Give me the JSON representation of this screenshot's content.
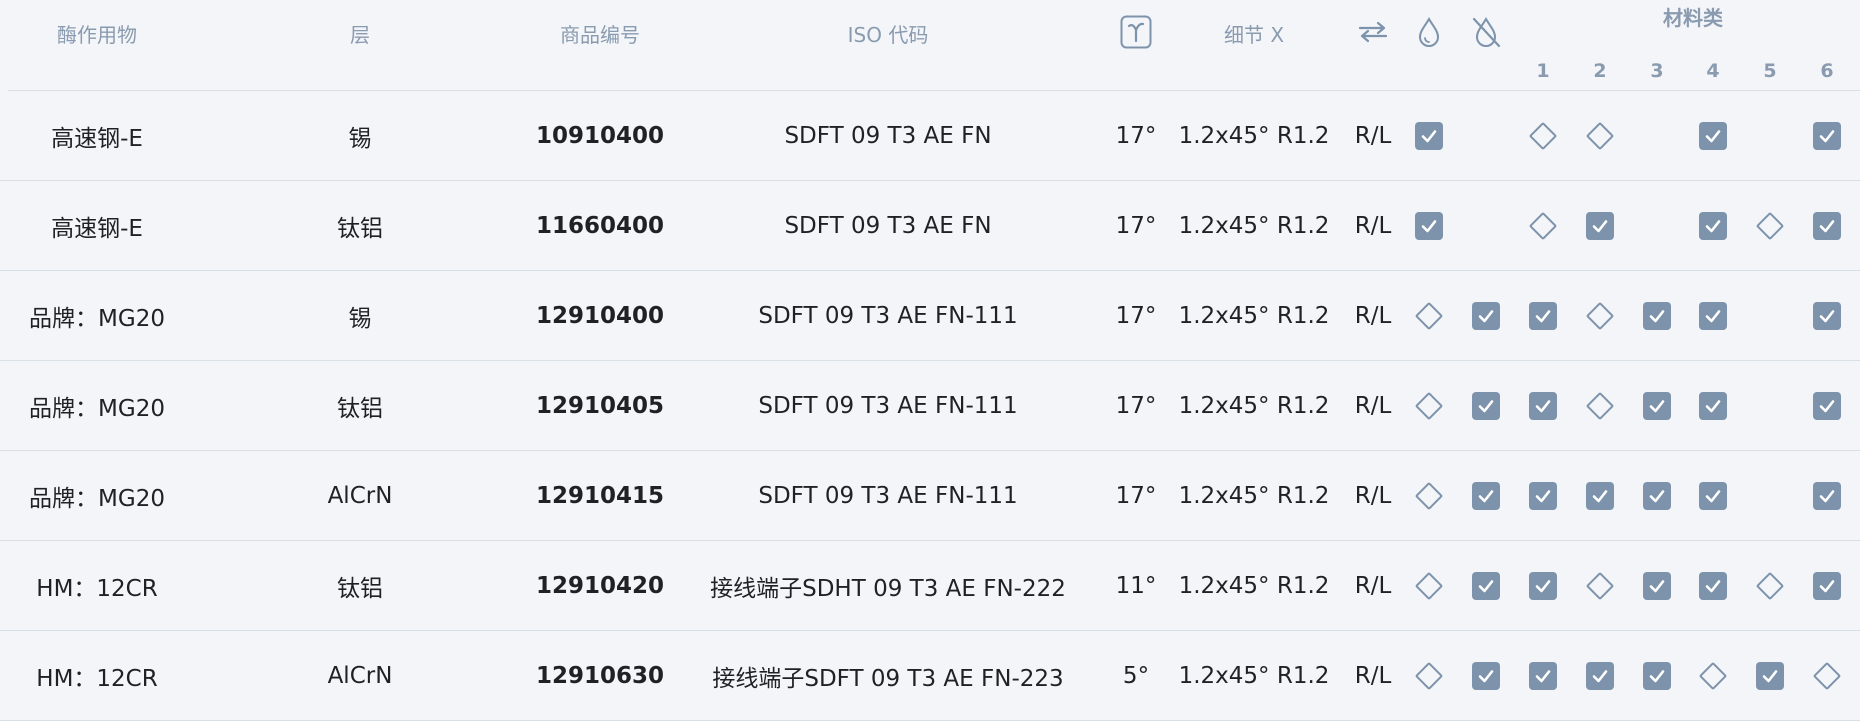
{
  "header": {
    "enzyme": "酶作用物",
    "layer": "层",
    "item_no": "商品编号",
    "iso": "ISO 代码",
    "detail": "细节 X",
    "material_class": "材料类",
    "material_numbers": [
      "1",
      "2",
      "3",
      "4",
      "5",
      "6"
    ],
    "icons": [
      "gamma-angle-icon",
      "swap-direction-icon",
      "coolant-icon",
      "no-coolant-icon"
    ]
  },
  "colors": {
    "accent": "#7d92ab",
    "header_text": "#8a9bb0",
    "background": "#f3f5f9",
    "divider": "#d9dfe7"
  },
  "rows": [
    {
      "enzyme": "高速钢-E",
      "layer": "锡",
      "item_no": "10910400",
      "iso": "SDFT 09 T3 AE FN",
      "angle": "17°",
      "detail": "1.2x45° R1.2",
      "direction": "R/L",
      "marks": [
        "check",
        "none",
        "diamond",
        "diamond",
        "none",
        "check",
        "none",
        "check"
      ]
    },
    {
      "enzyme": "高速钢-E",
      "layer": "钛铝",
      "item_no": "11660400",
      "iso": "SDFT 09 T3 AE FN",
      "angle": "17°",
      "detail": "1.2x45° R1.2",
      "direction": "R/L",
      "marks": [
        "check",
        "none",
        "diamond",
        "check",
        "none",
        "check",
        "diamond",
        "check"
      ]
    },
    {
      "enzyme": "品牌：MG20",
      "layer": "锡",
      "item_no": "12910400",
      "iso": "SDFT 09 T3 AE FN-111",
      "angle": "17°",
      "detail": "1.2x45° R1.2",
      "direction": "R/L",
      "marks": [
        "diamond",
        "check",
        "check",
        "diamond",
        "check",
        "check",
        "none",
        "check"
      ]
    },
    {
      "enzyme": "品牌：MG20",
      "layer": "钛铝",
      "item_no": "12910405",
      "iso": "SDFT 09 T3 AE FN-111",
      "angle": "17°",
      "detail": "1.2x45° R1.2",
      "direction": "R/L",
      "marks": [
        "diamond",
        "check",
        "check",
        "diamond",
        "check",
        "check",
        "none",
        "check"
      ]
    },
    {
      "enzyme": "品牌：MG20",
      "layer": "AlCrN",
      "item_no": "12910415",
      "iso": "SDFT 09 T3 AE FN-111",
      "angle": "17°",
      "detail": "1.2x45° R1.2",
      "direction": "R/L",
      "marks": [
        "diamond",
        "check",
        "check",
        "check",
        "check",
        "check",
        "none",
        "check"
      ]
    },
    {
      "enzyme": "HM：12CR",
      "layer": "钛铝",
      "item_no": "12910420",
      "iso": "接线端子SDHT 09 T3 AE FN-222",
      "angle": "11°",
      "detail": "1.2x45° R1.2",
      "direction": "R/L",
      "marks": [
        "diamond",
        "check",
        "check",
        "diamond",
        "check",
        "check",
        "diamond",
        "check"
      ]
    },
    {
      "enzyme": "HM：12CR",
      "layer": "AlCrN",
      "item_no": "12910630",
      "iso": "接线端子SDFT 09 T3 AE FN-223",
      "angle": "5°",
      "detail": "1.2x45° R1.2",
      "direction": "R/L",
      "marks": [
        "diamond",
        "check",
        "check",
        "check",
        "check",
        "diamond",
        "check",
        "diamond"
      ]
    }
  ]
}
